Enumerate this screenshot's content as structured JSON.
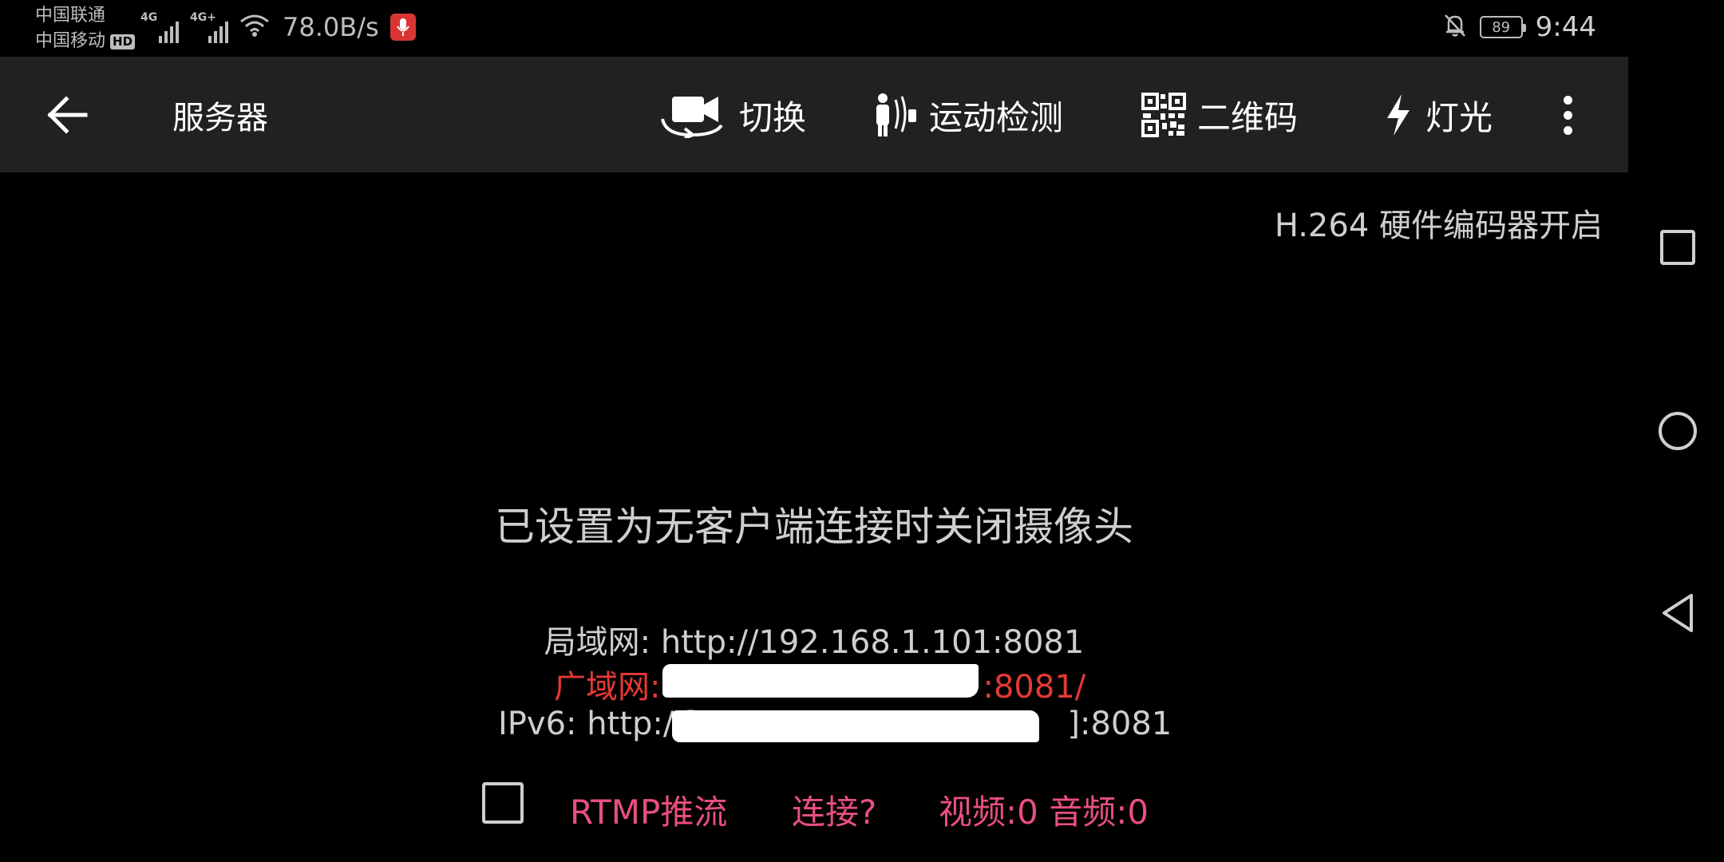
{
  "status_bar": {
    "carrier_1": "中国联通",
    "carrier_2": "中国移动",
    "hd_badge": "HD",
    "network_1": "4G",
    "network_2": "4G+",
    "net_speed": "78.0B/s",
    "battery": "89",
    "time": "9:44",
    "icons": [
      "signal-icon",
      "wifi-icon",
      "microphone-icon",
      "bell-off-icon",
      "battery-icon"
    ]
  },
  "app_bar": {
    "title": "服务器",
    "actions": {
      "switch": "切换",
      "motion": "运动检测",
      "qrcode": "二维码",
      "light": "灯光"
    },
    "icons": [
      "back-arrow-icon",
      "camera-switch-icon",
      "motion-detect-icon",
      "qr-code-icon",
      "flash-icon",
      "more-vert-icon"
    ]
  },
  "main": {
    "encoder_status": "H.264 硬件编码器开启",
    "message": "已设置为无客户端连接时关闭摄像头",
    "lan": "局域网: http://192.168.1.101:8081",
    "wan_prefix": "广域网:",
    "wan_suffix": ":8081/",
    "ipv6_prefix": "IPv6: http://[",
    "ipv6_suffix": "]:8081",
    "rtmp_label": "RTMP推流",
    "rtmp_checked": false,
    "connection_status": "连接?",
    "av_stats": "视频:0 音频:0"
  },
  "colors": {
    "app_bar_bg": "#212121",
    "wan_text": "#e53935",
    "rtmp_text": "#e8507e",
    "mic_badge": "#d93535"
  },
  "nav_bar": {
    "icons": [
      "recents-square-icon",
      "home-circle-icon",
      "back-triangle-icon"
    ]
  }
}
